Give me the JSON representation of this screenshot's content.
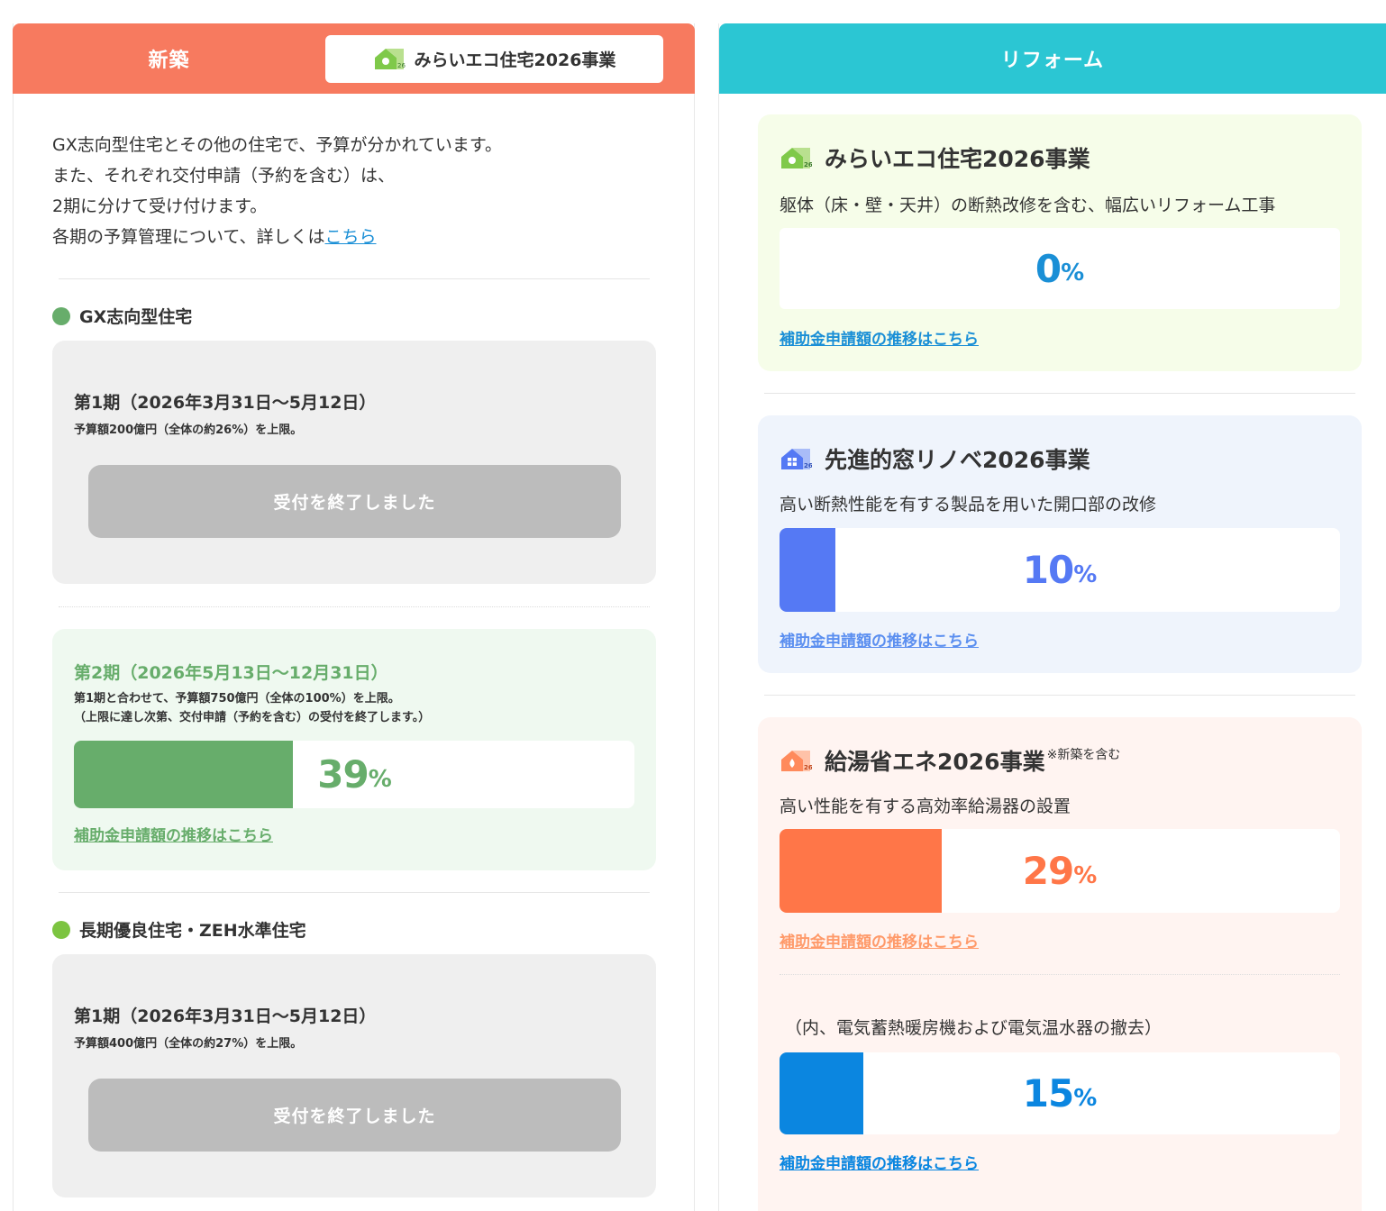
{
  "left": {
    "tab_label": "新築",
    "pill_label": "みらいエコ住宅2026事業",
    "intro": [
      "GX志向型住宅とその他の住宅で、予算が分かれています。",
      "また、それぞれ交付申請（予約を含む）は、",
      "2期に分けて受け付けます。",
      "各期の予算管理について、詳しくは"
    ],
    "intro_link": "こちら",
    "gx": {
      "heading": "GX志向型住宅",
      "phase1_title": "第1期（2026年3月31日〜5月12日）",
      "phase1_sub": "予算額200億円（全体の約26%）を上限。",
      "phase1_button": "受付を終了しました",
      "phase2_title": "第2期（2026年5月13日〜12月31日）",
      "phase2_sub1": "第1期と合わせて、予算額750億円（全体の100%）を上限。",
      "phase2_sub2": "（上限に達し次第、交付申請（予約を含む）の受付を終了します。）",
      "phase2_progress": 39,
      "phase2_link": "補助金申請額の推移はこちら"
    },
    "zeh": {
      "heading": "長期優良住宅・ZEH水準住宅",
      "phase1_title": "第1期（2026年3月31日〜5月12日）",
      "phase1_sub": "予算額400億円（全体の約27%）を上限。",
      "phase1_button": "受付を終了しました"
    }
  },
  "right": {
    "tab_label": "リフォーム",
    "mirai": {
      "title": "みらいエコ住宅2026事業",
      "desc": "躯体（床・壁・天井）の断熱改修を含む、幅広いリフォーム工事",
      "progress": 0,
      "link": "補助金申請額の推移はこちら"
    },
    "window": {
      "title": "先進的窓リノベ2026事業",
      "desc": "高い断熱性能を有する製品を用いた開口部の改修",
      "progress": 10,
      "link": "補助金申請額の推移はこちら"
    },
    "water": {
      "title": "給湯省エネ2026事業",
      "note": "※新築を含む",
      "desc": "高い性能を有する高効率給湯器の設置",
      "progress": 29,
      "link": "補助金申請額の推移はこちら",
      "sub_desc": "（内、電気蓄熱暖房機および電気温水器の撤去）",
      "sub_progress": 15,
      "sub_link": "補助金申請額の推移はこちら"
    }
  },
  "percent_sign": "%",
  "colors": {
    "orange_header": "#f77a5f",
    "teal_header": "#2bc6d3",
    "gx_green": "#67ad6b",
    "zeh_dot": "#7cc441",
    "mirai_blue": "#1a8fd6",
    "window_blue": "#5579f4",
    "water_orange": "#ff7648",
    "sub_blue": "#0b86e0"
  }
}
